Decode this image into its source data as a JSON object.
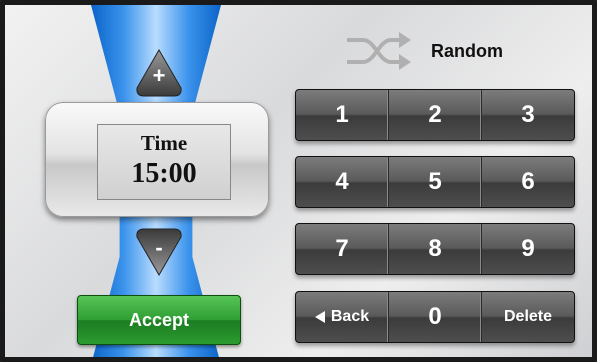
{
  "time_panel": {
    "label": "Time",
    "value": "15:00"
  },
  "increment": {
    "symbol": "+"
  },
  "decrement": {
    "symbol": "-"
  },
  "accept_label": "Accept",
  "random_label": "Random",
  "keypad": {
    "row1": [
      "1",
      "2",
      "3"
    ],
    "row2": [
      "4",
      "5",
      "6"
    ],
    "row3": [
      "7",
      "8",
      "9"
    ],
    "row4": {
      "back": "Back",
      "zero": "0",
      "delete": "Delete"
    }
  },
  "colors": {
    "accent_blue": "#3b93ec",
    "accept_green": "#2f9e34",
    "key_dark": "#4e4e4e"
  }
}
